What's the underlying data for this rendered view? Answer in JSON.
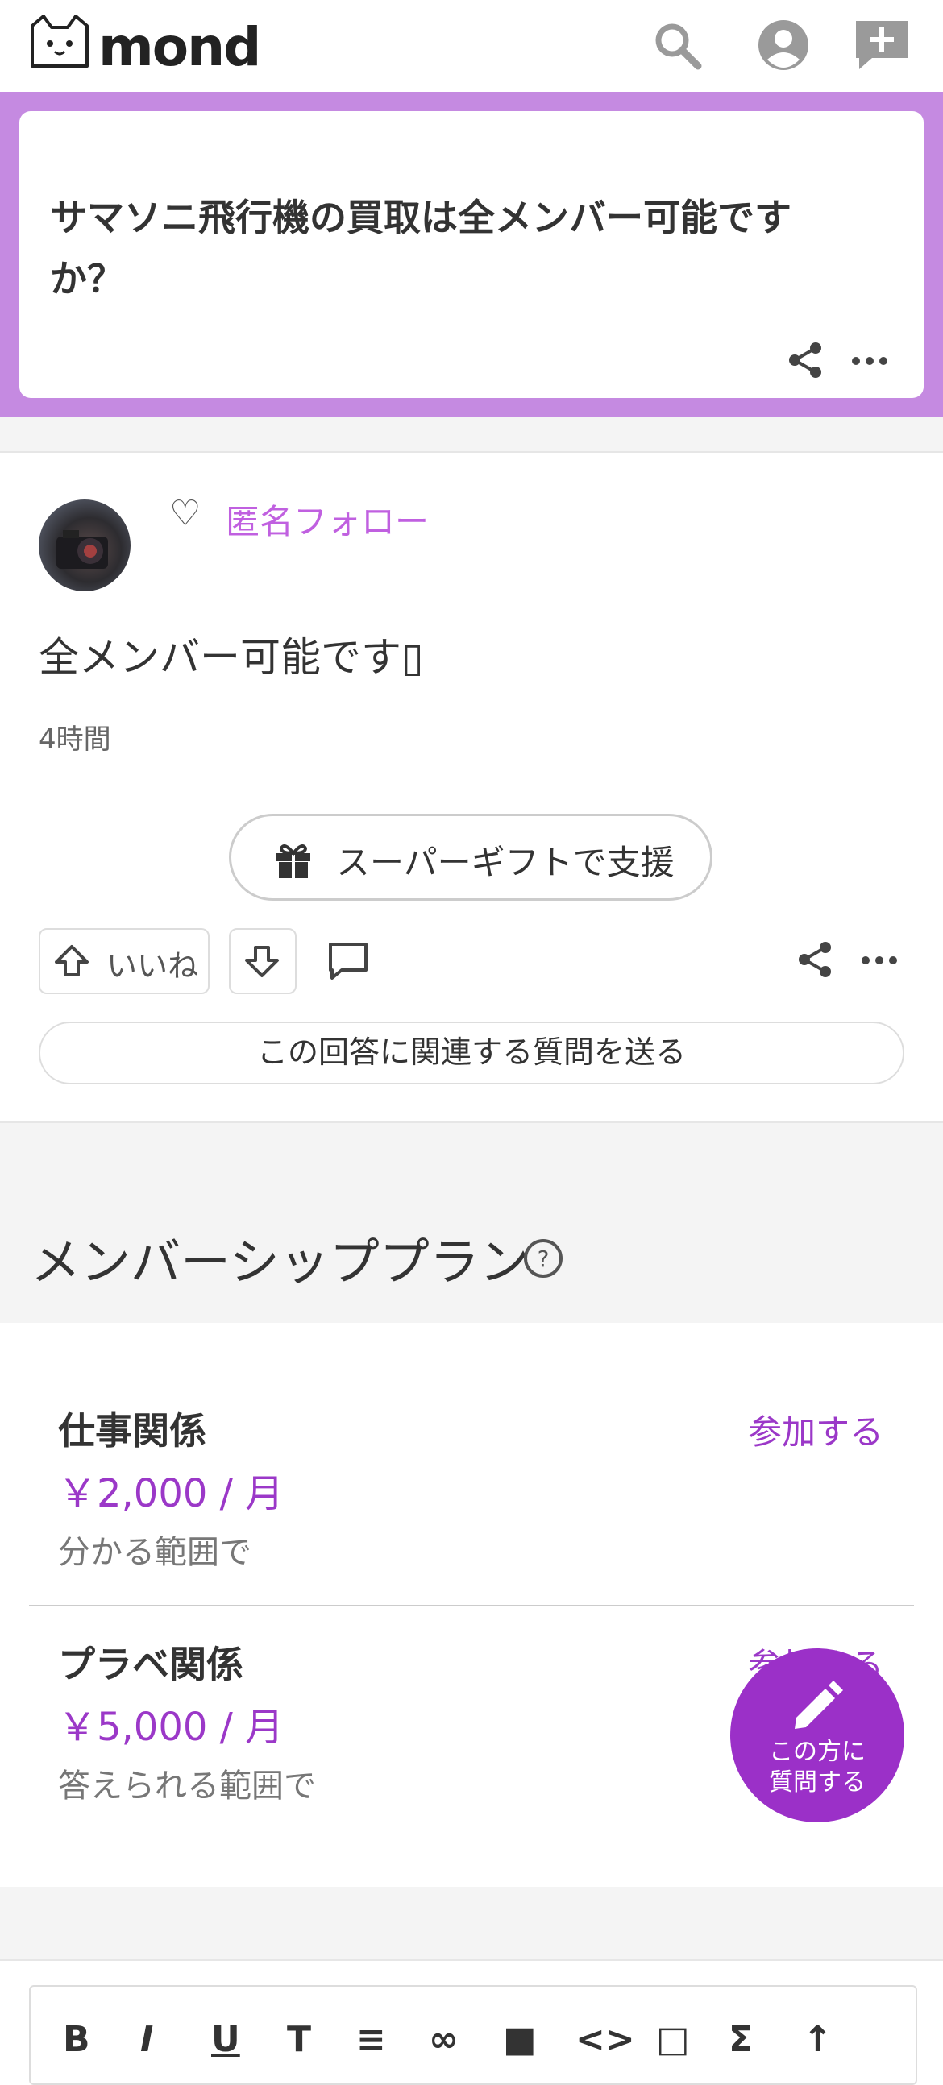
{
  "header": {
    "logo_text": "mond"
  },
  "question": {
    "title": "サマソニ飛行機の買取は全メンバー可能ですか？"
  },
  "answer": {
    "follow_label": "匿名フォロー",
    "text": "全メンバー可能です▯",
    "time": "4時間",
    "gift_button": "スーパーギフトで支援",
    "like_label": "いいね",
    "related_button": "この回答に関連する質問を送る"
  },
  "membership": {
    "title": "メンバーシッププラン",
    "plans": [
      {
        "name": "仕事関係",
        "price": "￥2,000 / 月",
        "desc": "分かる範囲で",
        "join": "参加する"
      },
      {
        "name": "プラベ関係",
        "price": "￥5,000 / 月",
        "desc": "答えられる範囲で",
        "join": "参加する"
      }
    ]
  },
  "fab": {
    "label_line1": "この方に",
    "label_line2": "質問する"
  },
  "editor": {
    "tools": [
      "B",
      "I",
      "U",
      "T",
      "≡",
      "∞",
      "■",
      "<>",
      "□",
      "Σ",
      "↑"
    ]
  },
  "colors": {
    "accent": "#c58ae1",
    "purple": "#9b38c8"
  }
}
